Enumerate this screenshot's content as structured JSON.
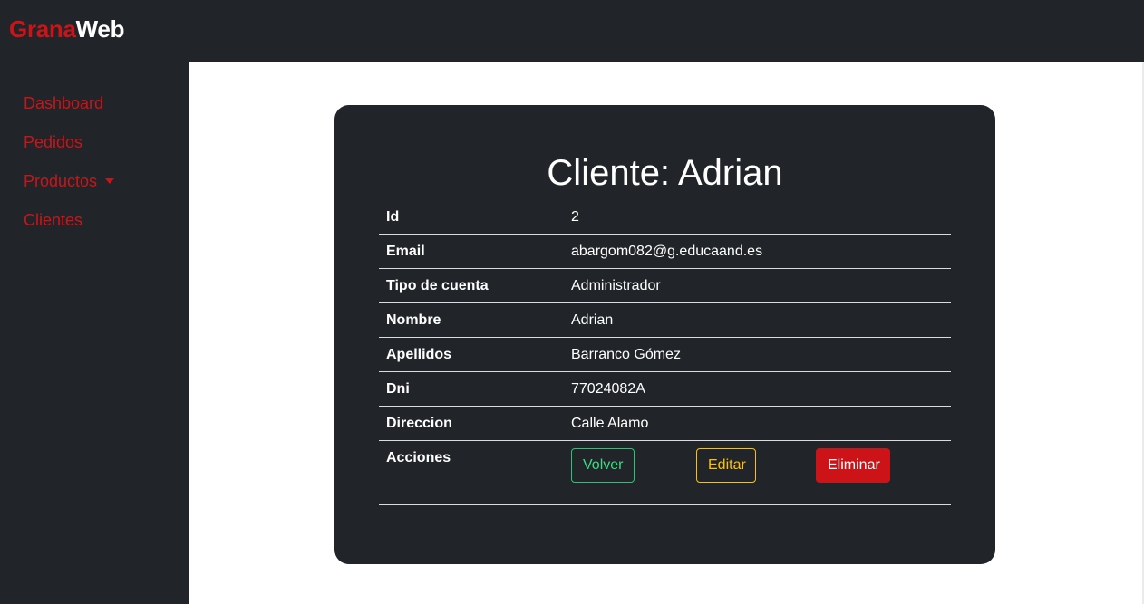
{
  "brand": {
    "part1": "Grana",
    "part2": "Web"
  },
  "sidebar": {
    "items": [
      {
        "label": "Dashboard"
      },
      {
        "label": "Pedidos"
      },
      {
        "label": "Productos",
        "has_dropdown": true
      },
      {
        "label": "Clientes"
      }
    ]
  },
  "card": {
    "title": "Cliente: Adrian",
    "rows": [
      {
        "key": "Id",
        "value": "2"
      },
      {
        "key": "Email",
        "value": "abargom082@g.educaand.es"
      },
      {
        "key": "Tipo de cuenta",
        "value": "Administrador"
      },
      {
        "key": "Nombre",
        "value": "Adrian"
      },
      {
        "key": "Apellidos",
        "value": "Barranco Gómez"
      },
      {
        "key": "Dni",
        "value": "77024082A"
      },
      {
        "key": "Direccion",
        "value": "Calle Alamo"
      }
    ],
    "actions": {
      "label": "Acciones",
      "volver": "Volver",
      "editar": "Editar",
      "eliminar": "Eliminar"
    }
  },
  "colors": {
    "brand_red": "#cc1418",
    "dark_bg": "#212529",
    "success": "#28c76f",
    "warning": "#ffc107"
  }
}
